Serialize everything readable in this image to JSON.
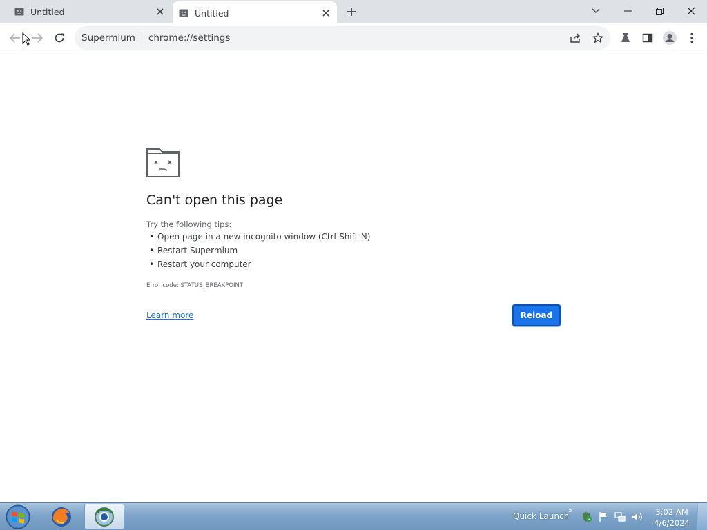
{
  "browser": {
    "tabs": [
      {
        "title": "Untitled",
        "active": false
      },
      {
        "title": "Untitled",
        "active": true
      }
    ],
    "address_bar": {
      "site_label": "Supermium",
      "url": "chrome://settings"
    }
  },
  "error_page": {
    "title": "Can't open this page",
    "tips_heading": "Try the following tips:",
    "tips": [
      "Open page in a new incognito window (Ctrl-Shift-N)",
      "Restart Supermium",
      "Restart your computer"
    ],
    "error_code": "Error code: STATUS_BREAKPOINT",
    "learn_more": "Learn more",
    "reload_label": "Reload"
  },
  "taskbar": {
    "quick_launch": "Quick Launch",
    "time": "3:02 AM",
    "date": "4/6/2024"
  },
  "colors": {
    "accent": "#1a73e8",
    "tabstrip": "#dee1e6",
    "omnibox": "#f1f3f4"
  }
}
